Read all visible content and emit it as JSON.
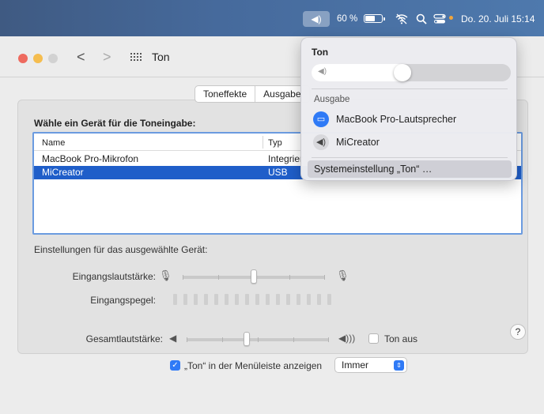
{
  "menubar": {
    "volume_icon": "speaker-volume-icon",
    "battery_percent": "60 %",
    "battery_level": 0.6,
    "wifi_icon": "wifi-off-icon",
    "search_icon": "magnifier-icon",
    "control_center_icon": "control-center-icon",
    "datetime": "Do. 20. Juli 15:14"
  },
  "window": {
    "title": "Ton",
    "back_glyph": "<",
    "forward_glyph": ">"
  },
  "tabs": [
    "Toneffekte",
    "Ausgabe"
  ],
  "input": {
    "heading": "Wähle ein Gerät für die Toneingabe:",
    "columns": [
      "Name",
      "Typ"
    ],
    "rows": [
      {
        "name": "MacBook Pro-Mikrofon",
        "type": "Integrier",
        "selected": false
      },
      {
        "name": "MiCreator",
        "type": "USB",
        "selected": true
      }
    ],
    "settings_label": "Einstellungen für das ausgewählte Gerät:",
    "input_volume_label": "Eingangslautstärke:",
    "input_volume_level": 0.5,
    "input_level_label": "Eingangspegel:",
    "input_level_active_bars": 0,
    "help_label": "?"
  },
  "output": {
    "total_volume_label": "Gesamtlautstärke:",
    "total_volume_level": 0.42,
    "mute_label": "Ton aus",
    "mute_checked": false,
    "show_in_menubar_label": "„Ton“ in der Menüleiste anzeigen",
    "show_in_menubar_checked": true,
    "show_mode": "Immer"
  },
  "menu": {
    "title": "Ton",
    "volume_level": 0.45,
    "section_label": "Ausgabe",
    "items": [
      {
        "label": "MacBook Pro-Lautsprecher",
        "icon": "laptop-icon",
        "active": true
      },
      {
        "label": "MiCreator",
        "icon": "speaker-icon",
        "active": false
      }
    ],
    "settings_item": "Systemeinstellung „Ton“ …"
  },
  "colors": {
    "accent": "#2f7af6",
    "selection": "#1f5ec9",
    "table_focus": "#6b9be0"
  }
}
